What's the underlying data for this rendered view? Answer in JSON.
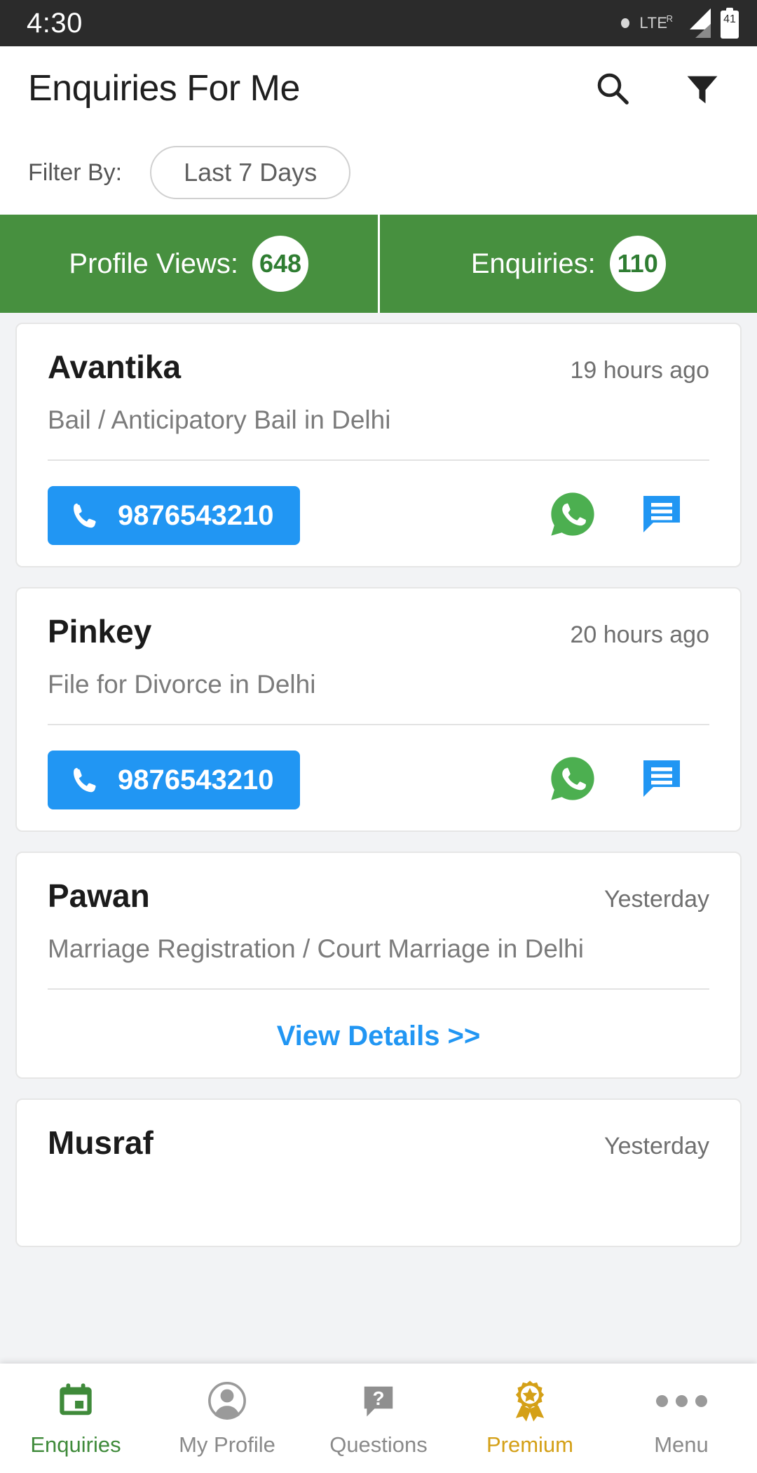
{
  "status_bar": {
    "time": "4:30",
    "network": "LTE",
    "network_sup": "R",
    "battery_level": "41"
  },
  "header": {
    "title": "Enquiries For Me",
    "search_icon": "search-icon",
    "filter_icon": "funnel-filter-icon"
  },
  "filter": {
    "label": "Filter By:",
    "selected": "Last 7 Days"
  },
  "stats": [
    {
      "label": "Profile Views:",
      "value": "648"
    },
    {
      "label": "Enquiries:",
      "value": "110"
    }
  ],
  "colors": {
    "stats_green": "#47903f",
    "call_blue": "#2196f3",
    "whatsapp_green": "#4caf50",
    "premium_gold": "#d4a017",
    "active_nav_green": "#3f8a3a"
  },
  "enquiries": [
    {
      "name": "Avantika",
      "time": "19 hours ago",
      "subject": "Bail / Anticipatory Bail in Delhi",
      "phone": "9876543210",
      "action_type": "contact"
    },
    {
      "name": "Pinkey",
      "time": "20 hours ago",
      "subject": "File for Divorce in Delhi",
      "phone": "9876543210",
      "action_type": "contact"
    },
    {
      "name": "Pawan",
      "time": "Yesterday",
      "subject": "Marriage Registration / Court Marriage in Delhi",
      "view_details_label": "View Details >>",
      "action_type": "view_details"
    },
    {
      "name": "Musraf",
      "time": "Yesterday",
      "action_type": "partial"
    }
  ],
  "bottom_nav": [
    {
      "label": "Enquiries",
      "icon": "calendar-icon",
      "active": true
    },
    {
      "label": "My Profile",
      "icon": "person-circle-icon",
      "active": false
    },
    {
      "label": "Questions",
      "icon": "question-bubble-icon",
      "active": false
    },
    {
      "label": "Premium",
      "icon": "award-ribbon-icon",
      "active": false
    },
    {
      "label": "Menu",
      "icon": "more-dots-icon",
      "active": false
    }
  ]
}
